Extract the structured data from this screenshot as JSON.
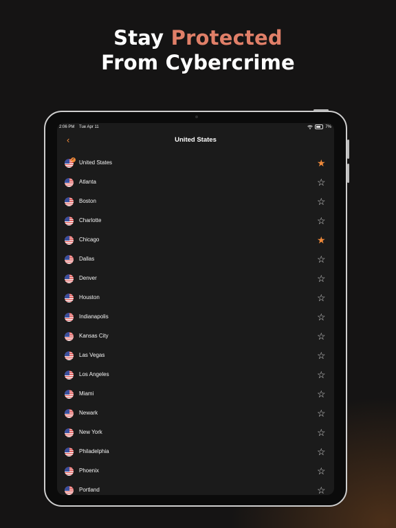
{
  "headline": {
    "line1_before": "Stay ",
    "line1_accent": "Protected",
    "line2": "From Cybercrime"
  },
  "colors": {
    "accent_text": "#e07f68",
    "orange": "#f08a3a",
    "background": "#151414"
  },
  "status_bar": {
    "time": "2:06 PM",
    "date": "Tue Apr 11",
    "wifi_icon": "wifi-icon",
    "battery_percent": "7%"
  },
  "nav": {
    "back_icon": "chevron-left-icon",
    "title": "United States"
  },
  "locations": [
    {
      "name": "United States",
      "favorite": true,
      "connected": true
    },
    {
      "name": "Atlanta",
      "favorite": false
    },
    {
      "name": "Boston",
      "favorite": false
    },
    {
      "name": "Charlotte",
      "favorite": false
    },
    {
      "name": "Chicago",
      "favorite": true
    },
    {
      "name": "Dallas",
      "favorite": false
    },
    {
      "name": "Denver",
      "favorite": false
    },
    {
      "name": "Houston",
      "favorite": false
    },
    {
      "name": "Indianapolis",
      "favorite": false
    },
    {
      "name": "Kansas City",
      "favorite": false
    },
    {
      "name": "Las Vegas",
      "favorite": false
    },
    {
      "name": "Los Angeles",
      "favorite": false
    },
    {
      "name": "Miami",
      "favorite": false
    },
    {
      "name": "Newark",
      "favorite": false
    },
    {
      "name": "New York",
      "favorite": false
    },
    {
      "name": "Philadelphia",
      "favorite": false
    },
    {
      "name": "Phoenix",
      "favorite": false
    },
    {
      "name": "Portland",
      "favorite": false
    }
  ]
}
